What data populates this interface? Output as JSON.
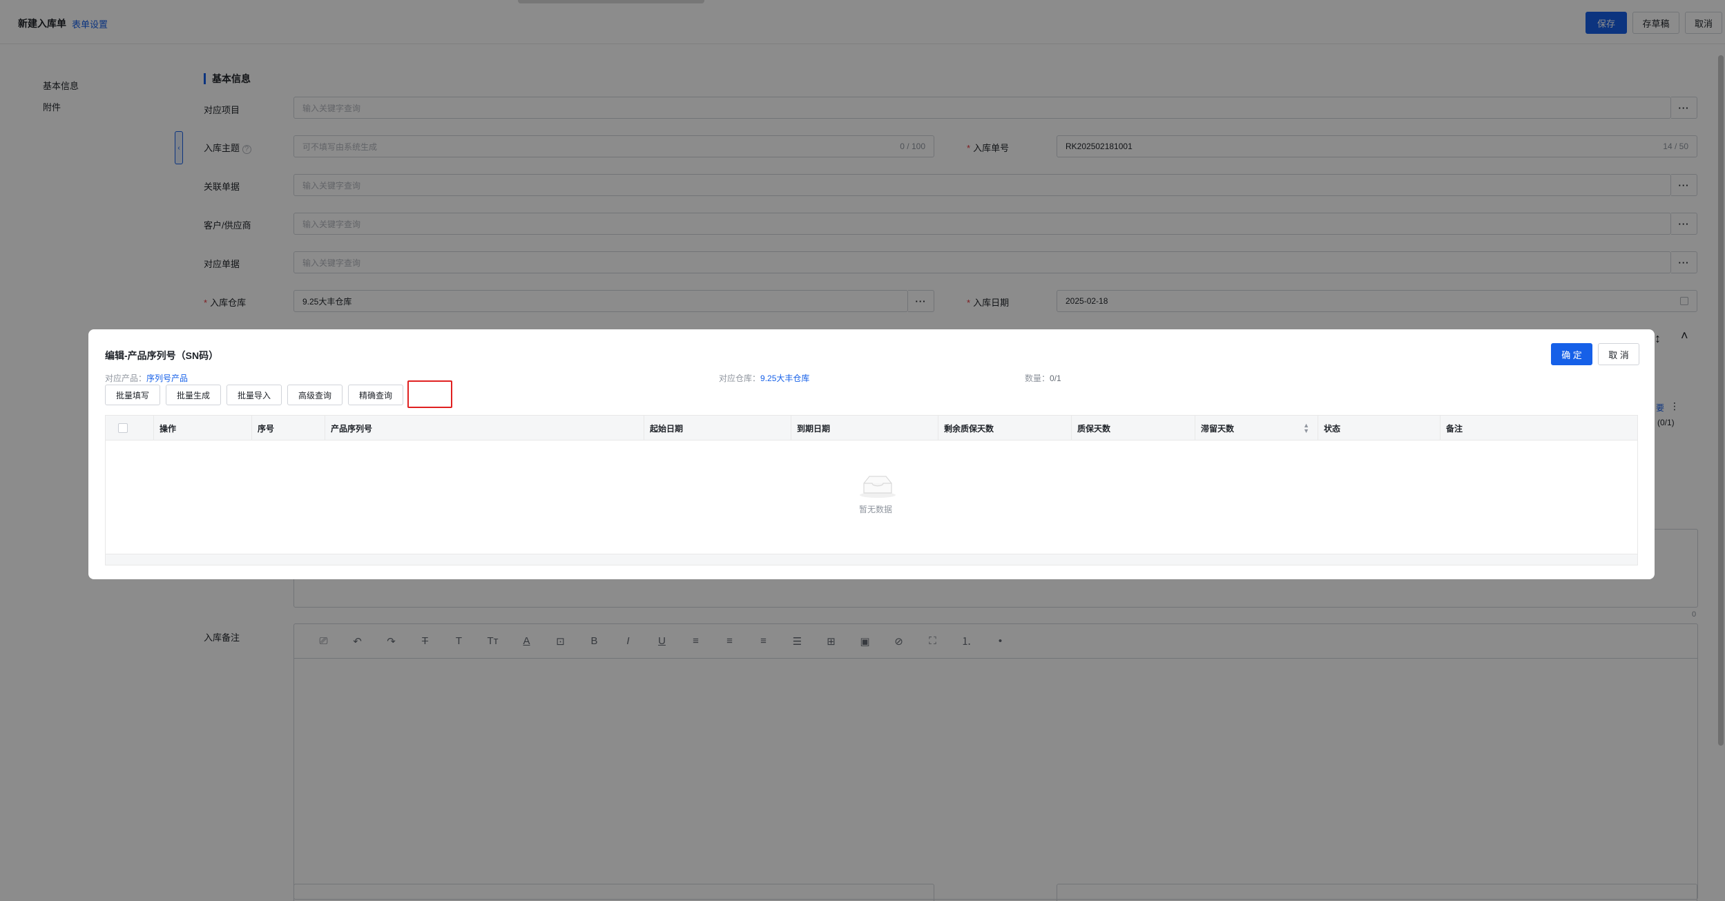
{
  "page": {
    "title": "新建入库单",
    "form_settings": "表单设置",
    "actions": {
      "save": "保存",
      "draft": "存草稿",
      "cancel": "取消"
    },
    "anchor_nav": [
      "基本信息",
      "附件"
    ],
    "section_title": "基本信息",
    "fields": {
      "project": {
        "label": "对应项目",
        "placeholder": "输入关键字查询"
      },
      "subject": {
        "label": "入库主题",
        "placeholder": "可不填写由系统生成",
        "count": "0 / 100"
      },
      "order_no": {
        "label": "入库单号",
        "value": "RK202502181001",
        "count": "14 / 50"
      },
      "related_doc": {
        "label": "关联单据",
        "placeholder": "输入关键字查询"
      },
      "customer": {
        "label": "客户/供应商",
        "placeholder": "输入关键字查询"
      },
      "source_doc": {
        "label": "对应单据",
        "placeholder": "输入关键字查询"
      },
      "warehouse": {
        "label": "入库仓库",
        "value": "9.25大丰仓库"
      },
      "date": {
        "label": "入库日期",
        "value": "2025-02-18"
      },
      "remark": {
        "label": "入库备注"
      }
    },
    "textarea_count": "0",
    "partial": {
      "link": "要",
      "count": "(0/1)"
    }
  },
  "modal": {
    "title": "编辑-产品序列号（SN码）",
    "confirm": "确 定",
    "cancel": "取 消",
    "info": {
      "product_label": "对应产品：",
      "product_value": "序列号产品",
      "warehouse_label": "对应仓库：",
      "warehouse_value": "9.25大丰仓库",
      "quantity_label": "数量：",
      "quantity_value": "0/1"
    },
    "toolbar": [
      "批量填写",
      "批量生成",
      "批量导入",
      "高级查询",
      "精确查询"
    ],
    "columns": [
      "操作",
      "序号",
      "产品序列号",
      "起始日期",
      "到期日期",
      "剩余质保天数",
      "质保天数",
      "滞留天数",
      "状态",
      "备注"
    ],
    "empty_text": "暂无数据"
  }
}
